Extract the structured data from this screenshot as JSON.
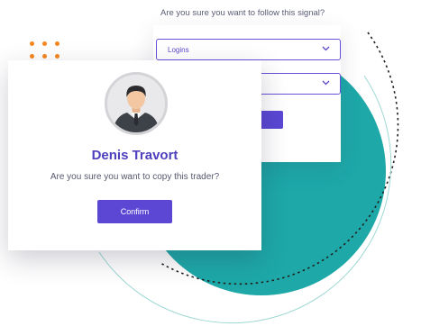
{
  "signal_dialog": {
    "question": "Are you sure you want to follow this signal?",
    "select_1": {
      "value": "Logins"
    },
    "select_2": {
      "value": ""
    }
  },
  "trader_dialog": {
    "name": "Denis Travort",
    "question": "Are you sure you want to copy this trader?",
    "confirm_label": "Confirm"
  },
  "colors": {
    "accent": "#5b47d4",
    "teal": "#1ea8a8",
    "dots": "#f6861f"
  }
}
